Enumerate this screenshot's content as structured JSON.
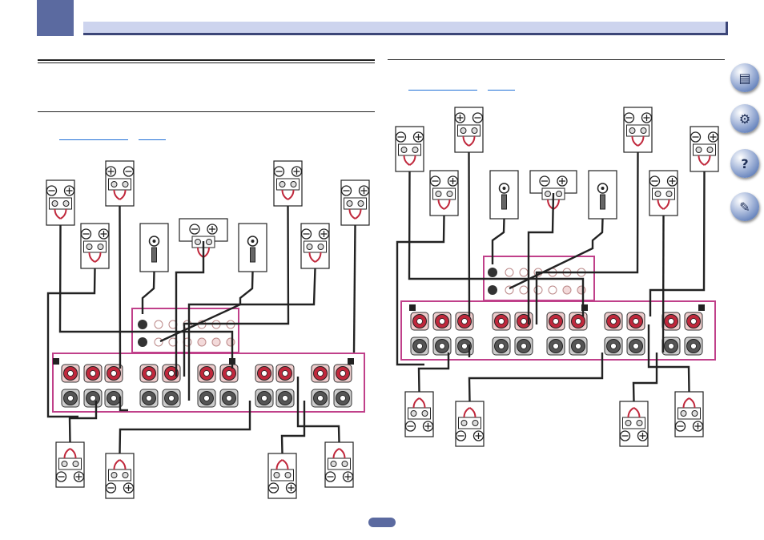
{
  "header": {
    "accent_color": "#5b6aa0",
    "bar_color": "#cdd4ee"
  },
  "left_panel": {
    "link_1": "",
    "link_2": ""
  },
  "right_panel": {
    "link_1": "",
    "link_2": ""
  },
  "nav": {
    "items": [
      {
        "name": "manual-icon",
        "glyph": "📖"
      },
      {
        "name": "settings-icon",
        "glyph": "⚙"
      },
      {
        "name": "faq-icon",
        "glyph": "?"
      },
      {
        "name": "tools-icon",
        "glyph": "✎"
      }
    ]
  },
  "colors": {
    "terminal_frame": "#c0408a",
    "wire": "#222222",
    "link": "#1f6fd6",
    "plus_terminal": "#c0283c",
    "minus_terminal": "#555555"
  }
}
